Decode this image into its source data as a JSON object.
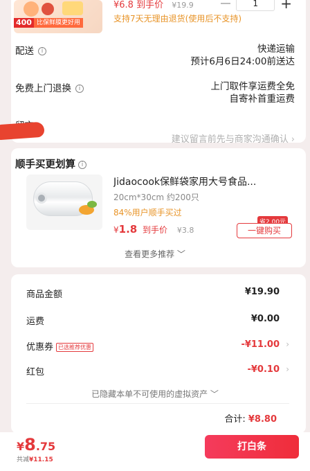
{
  "top_item": {
    "promo_badge_num": "400",
    "promo_badge_text": "比保鲜膜更好用",
    "price": "¥6.8",
    "price_label": "到手价",
    "orig_price": "¥19.9",
    "qty": "1",
    "support_text": "支持7天无理由退货(使用后不支持)"
  },
  "delivery": {
    "label": "配送",
    "method": "快递运输",
    "eta": "预计6月6日24:00前送达"
  },
  "return_service": {
    "label": "免费上门退换",
    "line1": "上门取件享运费全免",
    "line2": "自寄补首重运费"
  },
  "note": {
    "label": "留言",
    "placeholder": "建议留言前先与商家沟通确认"
  },
  "upsell": {
    "title": "顺手买更划算",
    "product_name": "Jidaocook保鲜袋家用大号食品...",
    "spec": "20cm*30cm 约200只",
    "stat": "84%用户顺手买过",
    "price_yen": "¥",
    "price": "1.8",
    "price_label": "到手价",
    "orig_price": "¥3.8",
    "save_badge": "省2.00元",
    "buy_label": "一键购买",
    "see_more": "查看更多推荐"
  },
  "summary": {
    "goods_label": "商品金额",
    "goods_value": "¥19.90",
    "shipping_label": "运费",
    "shipping_value": "¥0.00",
    "coupon_label": "优惠券",
    "coupon_tag": "已选推荐优惠",
    "coupon_value": "-¥11.00",
    "redpacket_label": "红包",
    "redpacket_value": "-¥0.10",
    "hidden_assets": "已隐藏本单不可使用的虚拟资产",
    "total_label": "合计:",
    "total_value": "¥8.80"
  },
  "bottom": {
    "yen": "¥",
    "int": "8",
    "dec": ".75",
    "saved_label": "共减",
    "saved_value": "¥11.15",
    "pay_label": "打白条"
  }
}
